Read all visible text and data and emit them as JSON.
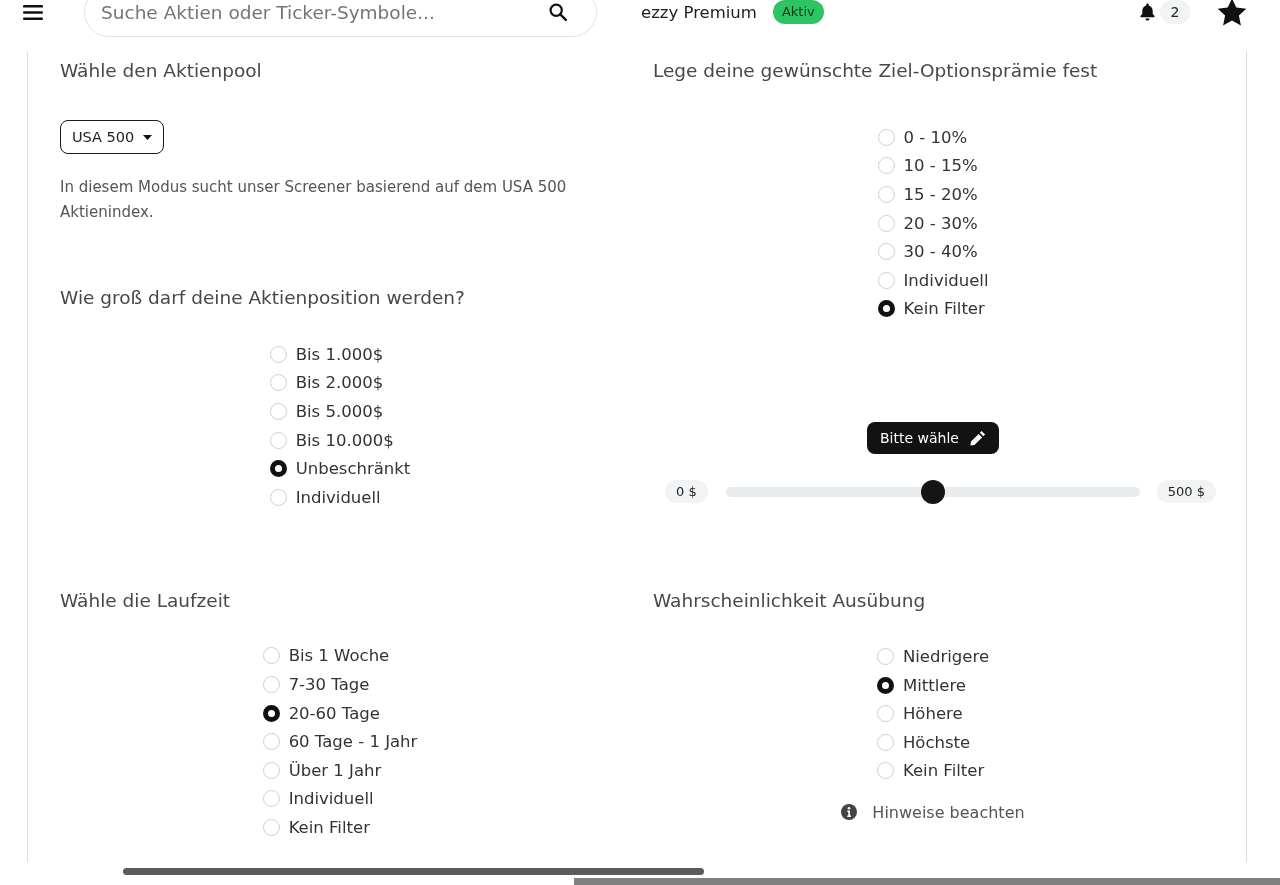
{
  "header": {
    "search": {
      "placeholder": "Suche Aktien oder Ticker-Symbole..."
    },
    "brand": "ezzy Premium",
    "status_badge": "Aktiv",
    "notification_count": "2"
  },
  "stock_pool": {
    "title": "Wähle den Aktienpool",
    "dropdown": "USA 500",
    "description": "In diesem Modus sucht unser Screener basierend auf dem USA 500 Aktienindex."
  },
  "position_size": {
    "title": "Wie groß darf deine Aktienposition werden?",
    "options": [
      {
        "label": "Bis 1.000$",
        "selected": false
      },
      {
        "label": "Bis 2.000$",
        "selected": false
      },
      {
        "label": "Bis 5.000$",
        "selected": false
      },
      {
        "label": "Bis 10.000$",
        "selected": false
      },
      {
        "label": "Unbeschränkt",
        "selected": true
      },
      {
        "label": "Individuell",
        "selected": false
      }
    ]
  },
  "premium": {
    "title": "Lege deine gewünschte Ziel-Optionsprämie fest",
    "options": [
      {
        "label": "0 - 10%",
        "selected": false
      },
      {
        "label": "10 - 15%",
        "selected": false
      },
      {
        "label": "15 - 20%",
        "selected": false
      },
      {
        "label": "20 - 30%",
        "selected": false
      },
      {
        "label": "30 - 40%",
        "selected": false
      },
      {
        "label": "Individuell",
        "selected": false
      },
      {
        "label": "Kein Filter",
        "selected": true
      }
    ],
    "slider": {
      "button": "Bitte wähle",
      "min": "0 $",
      "max": "500 $",
      "level": 0.5
    }
  },
  "term": {
    "title": "Wähle die Laufzeit",
    "options": [
      {
        "label": "Bis 1 Woche",
        "selected": false
      },
      {
        "label": "7-30 Tage",
        "selected": false
      },
      {
        "label": "20-60 Tage",
        "selected": true
      },
      {
        "label": "60 Tage - 1 Jahr",
        "selected": false
      },
      {
        "label": "Über 1 Jahr",
        "selected": false
      },
      {
        "label": "Individuell",
        "selected": false
      },
      {
        "label": "Kein Filter",
        "selected": false
      }
    ]
  },
  "exercise_probability": {
    "title": "Wahrscheinlichkeit Ausübung",
    "options": [
      {
        "label": "Niedrigere",
        "selected": false
      },
      {
        "label": "Mittlere",
        "selected": true
      },
      {
        "label": "Höhere",
        "selected": false
      },
      {
        "label": "Höchste",
        "selected": false
      },
      {
        "label": "Kein Filter",
        "selected": false
      }
    ],
    "note": "Hinweise beachten"
  }
}
